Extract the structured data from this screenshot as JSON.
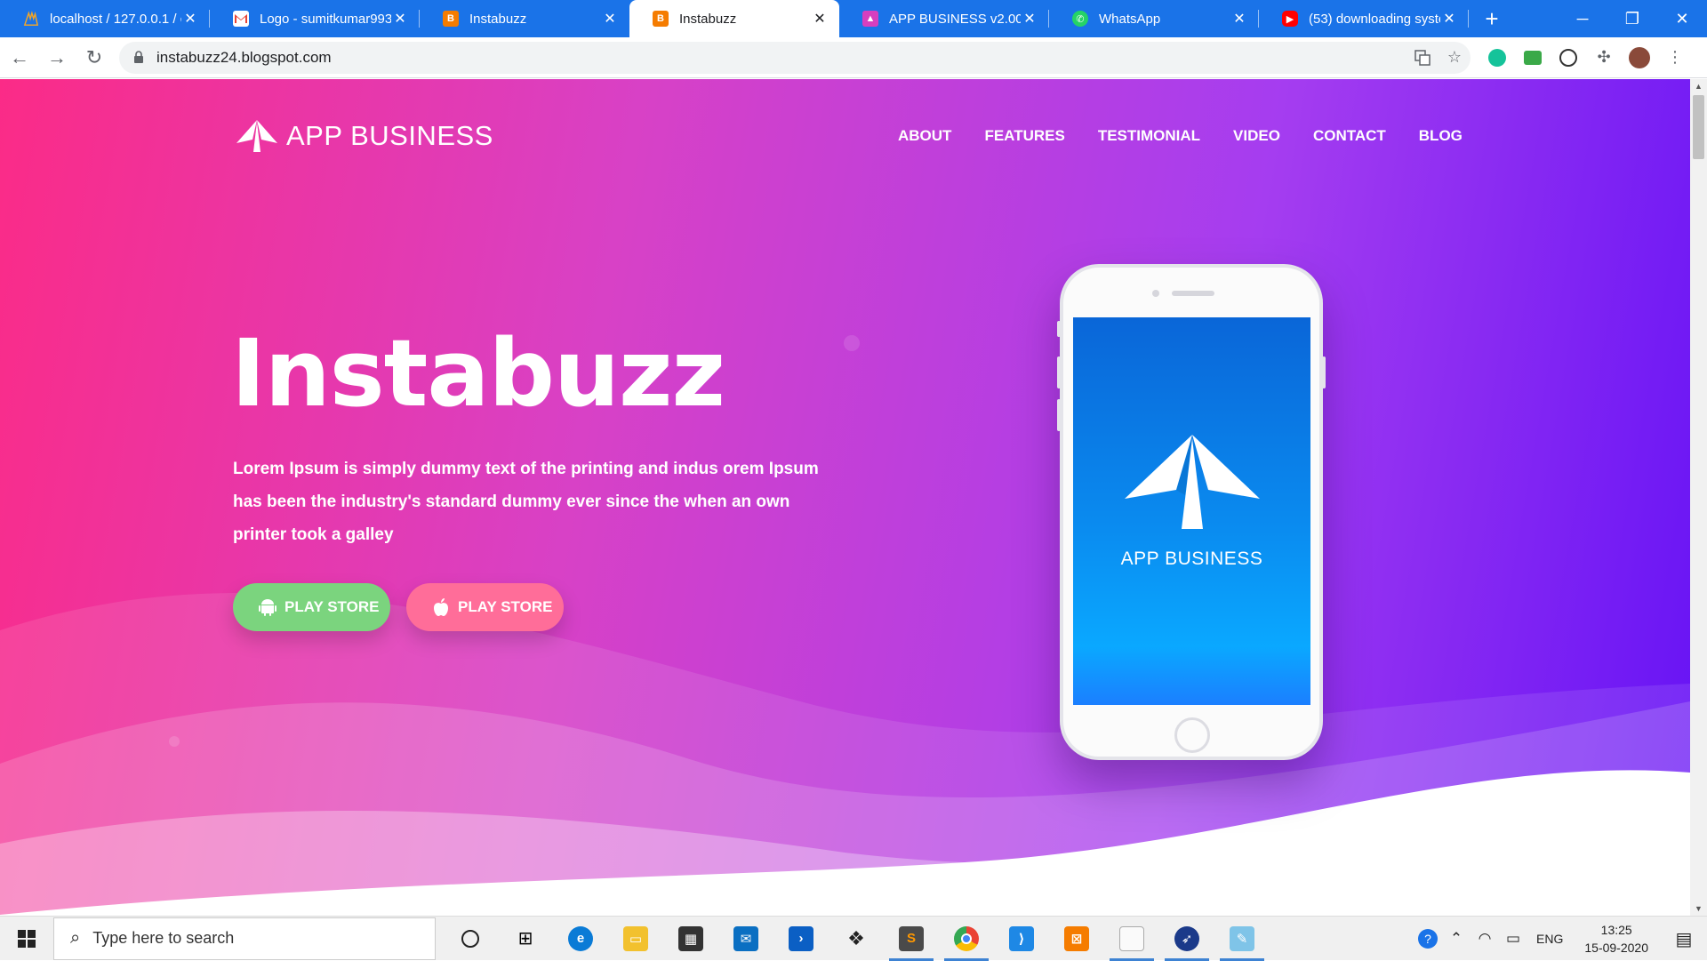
{
  "browser": {
    "tabs": [
      {
        "title": "localhost / 127.0.0.1 / c",
        "favicon": "phpmyadmin-icon",
        "color": "#e0a33b",
        "active": false
      },
      {
        "title": "Logo - sumitkumar993",
        "favicon": "gmail-icon",
        "color": "#ea4335",
        "active": false
      },
      {
        "title": "Instabuzz",
        "favicon": "blogger-icon",
        "color": "#f57c00",
        "active": false
      },
      {
        "title": "Instabuzz",
        "favicon": "blogger-icon",
        "color": "#f57c00",
        "active": true
      },
      {
        "title": "APP BUSINESS v2.00",
        "favicon": "app-business-icon",
        "color": "#d63fbf",
        "active": false
      },
      {
        "title": "WhatsApp",
        "favicon": "whatsapp-icon",
        "color": "#25d366",
        "active": false
      },
      {
        "title": "(53) downloading syste",
        "favicon": "youtube-icon",
        "color": "#ff0000",
        "active": false
      }
    ],
    "url": "instabuzz24.blogspot.com"
  },
  "site": {
    "brand": "APP BUSINESS",
    "menu": [
      "ABOUT",
      "FEATURES",
      "TESTIMONIAL",
      "VIDEO",
      "CONTACT",
      "BLOG"
    ],
    "hero_title": "Instabuzz",
    "hero_text": "Lorem Ipsum is simply dummy text of the printing and indus orem Ipsum has been the industry's standard dummy ever since the when an own printer took a galley",
    "buttons": [
      {
        "label": "PLAY STORE",
        "icon": "android-icon"
      },
      {
        "label": "PLAY STORE",
        "icon": "apple-icon"
      }
    ],
    "phone_screen_text": "APP BUSINESS",
    "colors": {
      "gradient_start": "#fb2b87",
      "gradient_end": "#6512f5",
      "android_button": "#7bd47e",
      "apple_button": "#ff6d99",
      "tab_strip": "#1a73e8"
    }
  },
  "taskbar": {
    "search_placeholder": "Type here to search",
    "language": "ENG",
    "time": "13:25",
    "date": "15-09-2020"
  }
}
